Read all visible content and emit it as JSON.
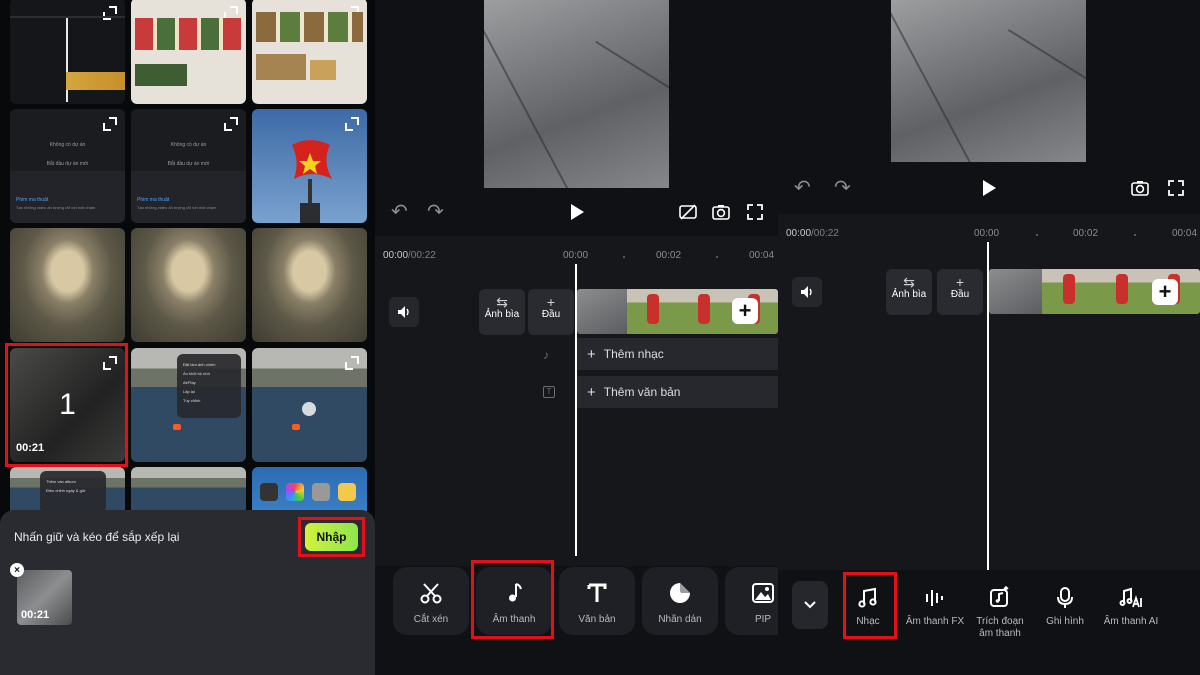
{
  "gallery": {
    "mini_texts": {
      "no_project": "Không có dự án",
      "start_new": "Bắt đầu dự án mới",
      "magic_film": "Phim ma thuật",
      "magic_desc": "Tạo những video ấn tượng chỉ với một chạm"
    },
    "selected_number": "1",
    "selected_duration": "00:21",
    "menu_items": [
      "Đặt làm ảnh chính",
      "Ẩn khỏi bộ nhớ",
      "AirPlay",
      "Lặp lại",
      "Tùy chỉnh"
    ],
    "album_items": [
      "Thêm vào album",
      "Điều chỉnh ngày & giờ"
    ],
    "hint": "Nhấn giữ và kéo để sắp xếp lại",
    "import_label": "Nhập",
    "picked_duration": "00:21",
    "remove_label": "×"
  },
  "editor1": {
    "time_current": "00:00",
    "time_total": "/00:22",
    "ticks": [
      "00:00",
      "00:02",
      "00:04"
    ],
    "cover_label": "Ảnh bìa",
    "start_label": "Đầu",
    "add_music": "Thêm nhạc",
    "add_text": "Thêm văn bản",
    "tools": [
      "Cắt xén",
      "Âm thanh",
      "Văn bản",
      "Nhãn dán",
      "PIP"
    ]
  },
  "editor2": {
    "time_current": "00:00",
    "time_total": "/00:22",
    "ticks": [
      "00:00",
      "00:02",
      "00:04"
    ],
    "cover_label": "Ảnh bìa",
    "start_label": "Đầu",
    "audio_tabs": [
      "Nhạc",
      "Âm thanh FX",
      "Trích đoạn âm thanh",
      "Ghi hình",
      "Âm thanh AI"
    ]
  },
  "colors": {
    "highlight": "#e3101c",
    "import_green": "#b7ec44",
    "background": "#101114"
  }
}
